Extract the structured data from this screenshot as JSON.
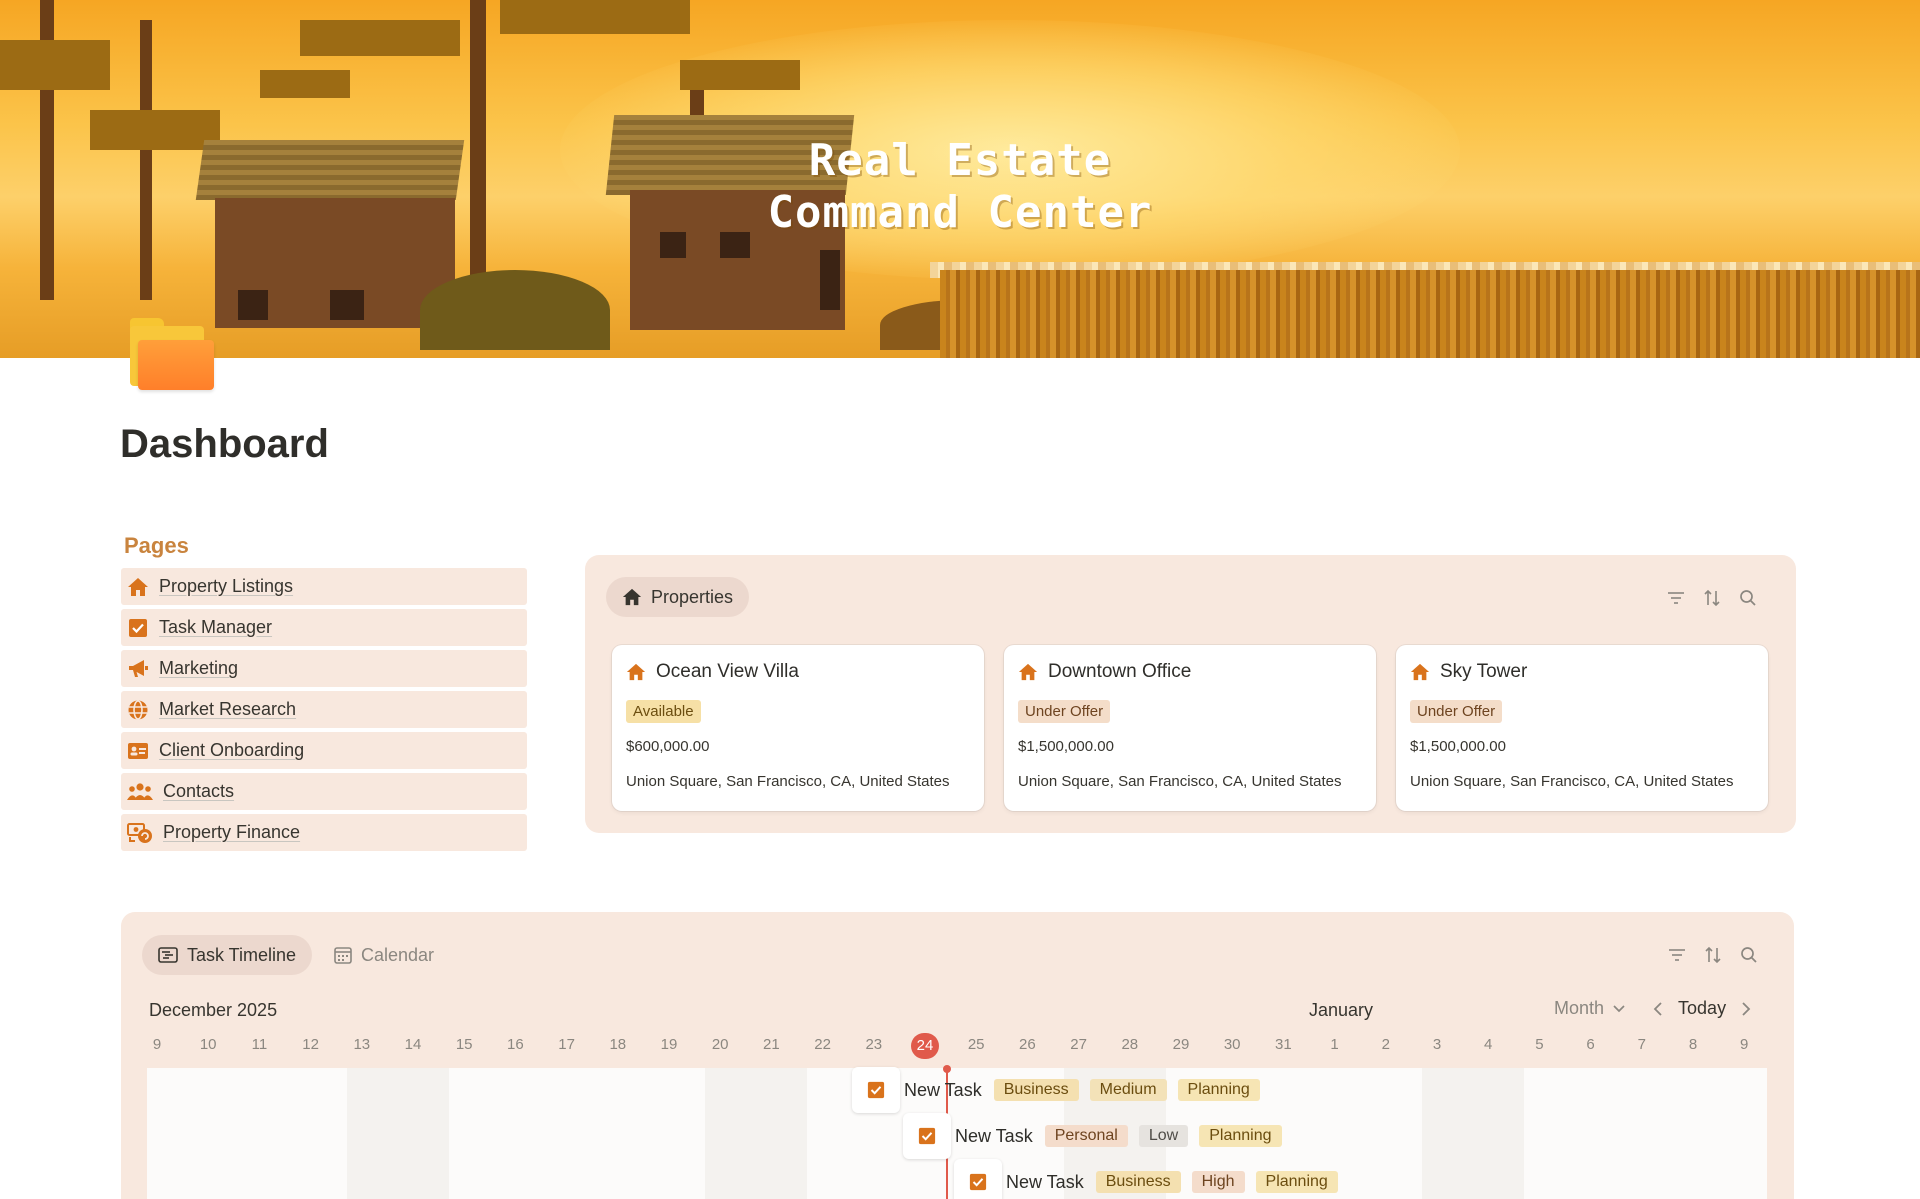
{
  "banner": {
    "title_line1": "Real Estate",
    "title_line2": "Command Center"
  },
  "page": {
    "title": "Dashboard",
    "icon": "folder-icon"
  },
  "pages_nav": {
    "heading": "Pages",
    "items": [
      {
        "label": "Property Listings",
        "icon": "house-icon"
      },
      {
        "label": "Task Manager",
        "icon": "checkbox-icon"
      },
      {
        "label": "Marketing",
        "icon": "megaphone-icon"
      },
      {
        "label": "Market Research",
        "icon": "globe-icon"
      },
      {
        "label": "Client Onboarding",
        "icon": "id-card-icon"
      },
      {
        "label": "Contacts",
        "icon": "people-icon"
      },
      {
        "label": "Property Finance",
        "icon": "money-cycle-icon"
      }
    ]
  },
  "properties": {
    "view_label": "Properties",
    "cards": [
      {
        "name": "Ocean View Villa",
        "status": "Available",
        "price": "$600,000.00",
        "address": "Union Square, San Francisco, CA, United States"
      },
      {
        "name": "Downtown Office",
        "status": "Under Offer",
        "price": "$1,500,000.00",
        "address": "Union Square, San Francisco, CA, United States"
      },
      {
        "name": "Sky Tower",
        "status": "Under Offer",
        "price": "$1,500,000.00",
        "address": "Union Square, San Francisco, CA, United States"
      }
    ]
  },
  "timeline": {
    "tabs": {
      "active": "Task Timeline",
      "inactive": "Calendar"
    },
    "month_left": "December 2025",
    "month_right": "January",
    "controls": {
      "scale": "Month",
      "today": "Today"
    },
    "days": [
      "9",
      "10",
      "11",
      "12",
      "13",
      "14",
      "15",
      "16",
      "17",
      "18",
      "19",
      "20",
      "21",
      "22",
      "23",
      "24",
      "25",
      "26",
      "27",
      "28",
      "29",
      "30",
      "31",
      "1",
      "2",
      "3",
      "4",
      "5",
      "6",
      "7",
      "8",
      "9"
    ],
    "today_index": 15,
    "tasks": [
      {
        "name": "New Task",
        "tags": [
          "Business",
          "Medium",
          "Planning"
        ]
      },
      {
        "name": "New Task",
        "tags": [
          "Personal",
          "Low",
          "Planning"
        ]
      },
      {
        "name": "New Task",
        "tags": [
          "Business",
          "High",
          "Planning"
        ]
      }
    ]
  },
  "colors": {
    "accent": "#d9731c",
    "panel": "#f8e8de",
    "today": "#e05a4b",
    "heading": "#c9843e"
  }
}
